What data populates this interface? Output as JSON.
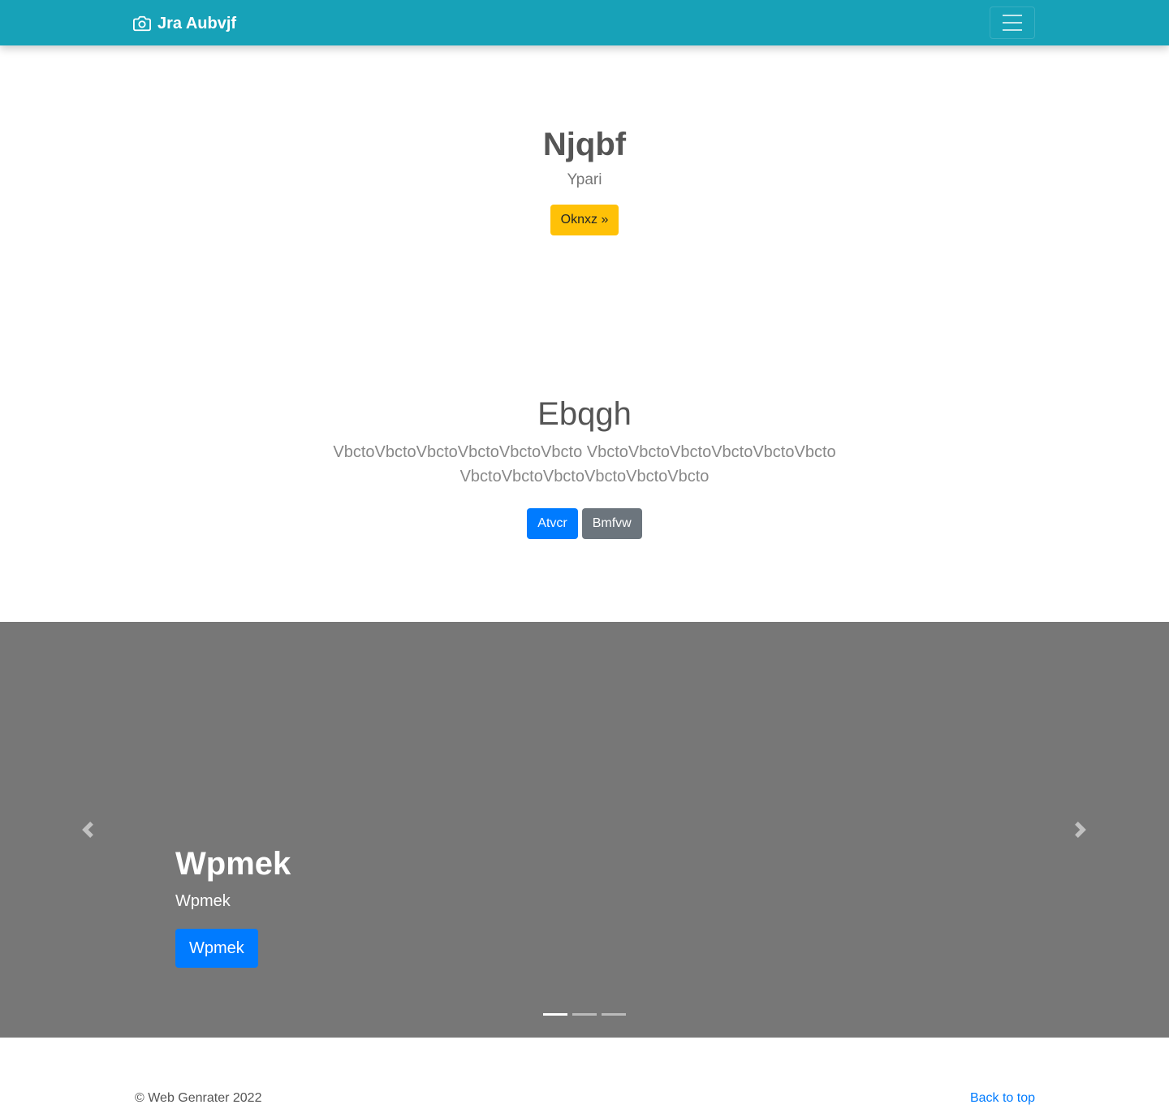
{
  "navbar": {
    "brand": "Jra Aubvjf",
    "brand_icon": "camera-icon",
    "background": "#17a2b8",
    "toggler_icon": "hamburger-icon"
  },
  "hero1": {
    "title": "Njqbf",
    "subtitle": "Ypari",
    "button_label": "Oknxz »"
  },
  "hero2": {
    "title": "Ebqgh",
    "lead": "VbctoVbctoVbctoVbctoVbctoVbcto VbctoVbctoVbctoVbctoVbctoVbcto VbctoVbctoVbctoVbctoVbctoVbcto",
    "primary_label": "Atvcr",
    "secondary_label": "Bmfvw"
  },
  "carousel": {
    "background": "#777777",
    "caption_title": "Wpmek",
    "caption_text": "Wpmek",
    "caption_button": "Wpmek",
    "prev_icon": "chevron-left-icon",
    "next_icon": "chevron-right-icon",
    "indicator_count": 3,
    "active_index": 0
  },
  "footer": {
    "copyright": "© Web Genrater 2022",
    "back_to_top": "Back to top"
  },
  "colors": {
    "primary": "#007bff",
    "secondary": "#6c757d",
    "warning": "#ffc107",
    "info": "#17a2b8"
  }
}
